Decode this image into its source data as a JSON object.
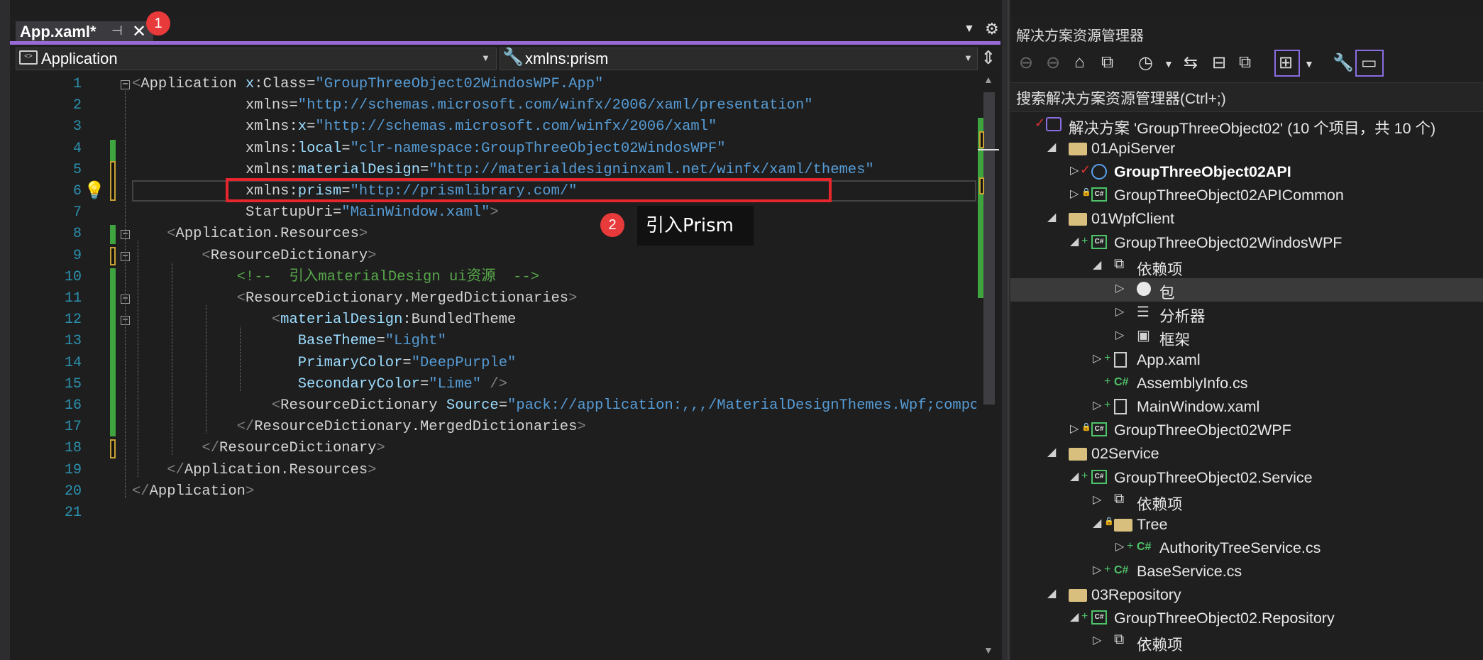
{
  "editor": {
    "tab": {
      "title": "App.xaml*",
      "pin_icon": "pin-icon",
      "close_icon": "close-icon"
    },
    "badge1": "1",
    "badge2": "2",
    "nav_left": "Application",
    "nav_right": "xmlns:prism",
    "tooltip": "引入Prism",
    "line_numbers": [
      "1",
      "2",
      "3",
      "4",
      "5",
      "6",
      "7",
      "8",
      "9",
      "10",
      "11",
      "12",
      "13",
      "14",
      "15",
      "16",
      "17",
      "18",
      "19",
      "20",
      "21"
    ],
    "lines": [
      [
        [
          "br",
          "<"
        ],
        [
          "tag",
          "Application "
        ],
        [
          "ns",
          "x"
        ],
        [
          "eq",
          ":"
        ],
        [
          "attr",
          "Class"
        ],
        [
          "eq",
          "="
        ],
        [
          "str",
          "\"GroupThreeObject02WindosWPF.App\""
        ]
      ],
      [
        [
          "sp",
          "             "
        ],
        [
          "attr",
          "xmlns"
        ],
        [
          "eq",
          "="
        ],
        [
          "str",
          "\"http://schemas.microsoft.com/winfx/2006/xaml/presentation\""
        ]
      ],
      [
        [
          "sp",
          "             "
        ],
        [
          "attr",
          "xmlns"
        ],
        [
          "eq",
          ":"
        ],
        [
          "ns",
          "x"
        ],
        [
          "eq",
          "="
        ],
        [
          "str",
          "\"http://schemas.microsoft.com/winfx/2006/xaml\""
        ]
      ],
      [
        [
          "sp",
          "             "
        ],
        [
          "attr",
          "xmlns"
        ],
        [
          "eq",
          ":"
        ],
        [
          "ns",
          "local"
        ],
        [
          "eq",
          "="
        ],
        [
          "str",
          "\"clr-namespace:GroupThreeObject02WindosWPF\""
        ]
      ],
      [
        [
          "sp",
          "             "
        ],
        [
          "attr",
          "xmlns"
        ],
        [
          "eq",
          ":"
        ],
        [
          "ns",
          "materialDesign"
        ],
        [
          "eq",
          "="
        ],
        [
          "str",
          "\"http://materialdesigninxaml.net/winfx/xaml/themes\""
        ]
      ],
      [
        [
          "sp",
          "             "
        ],
        [
          "attr",
          "xmlns"
        ],
        [
          "eq",
          ":"
        ],
        [
          "ns",
          "prism"
        ],
        [
          "eq",
          "="
        ],
        [
          "str",
          "\"http://prismlibrary.com/\""
        ]
      ],
      [
        [
          "sp",
          "             "
        ],
        [
          "attr",
          "StartupUri"
        ],
        [
          "eq",
          "="
        ],
        [
          "str",
          "\"MainWindow.xaml\""
        ],
        [
          "br",
          ">"
        ]
      ],
      [
        [
          "sp",
          "    "
        ],
        [
          "br",
          "<"
        ],
        [
          "tag",
          "Application.Resources"
        ],
        [
          "br",
          ">"
        ]
      ],
      [
        [
          "sp",
          "        "
        ],
        [
          "br",
          "<"
        ],
        [
          "tag",
          "ResourceDictionary"
        ],
        [
          "br",
          ">"
        ]
      ],
      [
        [
          "sp",
          "            "
        ],
        [
          "cmt",
          "<!--  引入materialDesign ui资源  -->"
        ]
      ],
      [
        [
          "sp",
          "            "
        ],
        [
          "br",
          "<"
        ],
        [
          "tag",
          "ResourceDictionary.MergedDictionaries"
        ],
        [
          "br",
          ">"
        ]
      ],
      [
        [
          "sp",
          "                "
        ],
        [
          "br",
          "<"
        ],
        [
          "ns",
          "materialDesign"
        ],
        [
          "eq",
          ":"
        ],
        [
          "tag",
          "BundledTheme"
        ]
      ],
      [
        [
          "sp",
          "                   "
        ],
        [
          "ns",
          "BaseTheme"
        ],
        [
          "eq",
          "="
        ],
        [
          "str",
          "\"Light\""
        ]
      ],
      [
        [
          "sp",
          "                   "
        ],
        [
          "ns",
          "PrimaryColor"
        ],
        [
          "eq",
          "="
        ],
        [
          "str",
          "\"DeepPurple\""
        ]
      ],
      [
        [
          "sp",
          "                   "
        ],
        [
          "ns",
          "SecondaryColor"
        ],
        [
          "eq",
          "="
        ],
        [
          "str",
          "\"Lime\" "
        ],
        [
          "br",
          "/>"
        ]
      ],
      [
        [
          "sp",
          "                "
        ],
        [
          "br",
          "<"
        ],
        [
          "tag",
          "ResourceDictionary "
        ],
        [
          "ns",
          "Source"
        ],
        [
          "eq",
          "="
        ],
        [
          "str",
          "\"pack://application:,,,/MaterialDesignThemes.Wpf;component/Themes/MaterialDesignTheme.Defaults.xaml\""
        ]
      ],
      [
        [
          "sp",
          "            "
        ],
        [
          "br",
          "</"
        ],
        [
          "tag",
          "ResourceDictionary.MergedDictionaries"
        ],
        [
          "br",
          ">"
        ]
      ],
      [
        [
          "sp",
          "        "
        ],
        [
          "br",
          "</"
        ],
        [
          "tag",
          "ResourceDictionary"
        ],
        [
          "br",
          ">"
        ]
      ],
      [
        [
          "sp",
          "    "
        ],
        [
          "br",
          "</"
        ],
        [
          "tag",
          "Application.Resources"
        ],
        [
          "br",
          ">"
        ]
      ],
      [
        [
          "br",
          "</"
        ],
        [
          "tag",
          "Application"
        ],
        [
          "br",
          ">"
        ]
      ],
      []
    ]
  },
  "solution_explorer": {
    "title": "解决方案资源管理器",
    "search_placeholder": "搜索解决方案资源管理器(Ctrl+;)",
    "toolbar_icons": [
      "back-icon",
      "forward-icon",
      "home-icon",
      "vs-switch-icon",
      "history-icon",
      "dropdown-icon",
      "sync-icon",
      "collapse-icon",
      "copy-icon",
      "show-all-icon",
      "dropdown-icon",
      "properties-icon",
      "preview-icon"
    ],
    "tree": [
      {
        "label": "解决方案 'GroupThreeObject02' (10 个项目，共 10 个)",
        "icon": "solution-icon",
        "depth": 0,
        "exp": "",
        "check": true
      },
      {
        "label": "01ApiServer",
        "icon": "folder-icon",
        "depth": 1,
        "exp": "◢"
      },
      {
        "label": "GroupThreeObject02API",
        "icon": "web-project-icon",
        "depth": 2,
        "exp": "▷",
        "check": true,
        "bold": true
      },
      {
        "label": "GroupThreeObject02APICommon",
        "icon": "csharp-project-icon",
        "depth": 2,
        "exp": "▷",
        "lock": true
      },
      {
        "label": "01WpfClient",
        "icon": "folder-icon",
        "depth": 1,
        "exp": "◢"
      },
      {
        "label": "GroupThreeObject02WindosWPF",
        "icon": "csharp-project-icon",
        "depth": 2,
        "exp": "◢",
        "plus": true
      },
      {
        "label": "依赖项",
        "icon": "dependencies-icon",
        "depth": 3,
        "exp": "◢"
      },
      {
        "label": "包",
        "icon": "package-icon",
        "depth": 4,
        "exp": "▷",
        "selected": true
      },
      {
        "label": "分析器",
        "icon": "analyzer-icon",
        "depth": 4,
        "exp": "▷"
      },
      {
        "label": "框架",
        "icon": "framework-icon",
        "depth": 4,
        "exp": "▷"
      },
      {
        "label": "App.xaml",
        "icon": "xaml-file-icon",
        "depth": 3,
        "exp": "▷",
        "plus": true
      },
      {
        "label": "AssemblyInfo.cs",
        "icon": "csharp-file-icon",
        "depth": 3,
        "exp": "",
        "plus": true
      },
      {
        "label": "MainWindow.xaml",
        "icon": "xaml-file-icon",
        "depth": 3,
        "exp": "▷",
        "plus": true
      },
      {
        "label": "GroupThreeObject02WPF",
        "icon": "csharp-project-icon",
        "depth": 2,
        "exp": "▷",
        "lock": true
      },
      {
        "label": "02Service",
        "icon": "folder-icon",
        "depth": 1,
        "exp": "◢"
      },
      {
        "label": "GroupThreeObject02.Service",
        "icon": "csharp-project-icon",
        "depth": 2,
        "exp": "◢",
        "plus": true
      },
      {
        "label": "依赖项",
        "icon": "dependencies-icon",
        "depth": 3,
        "exp": "▷"
      },
      {
        "label": "Tree",
        "icon": "folder-icon",
        "depth": 3,
        "exp": "◢",
        "lock": true
      },
      {
        "label": "AuthorityTreeService.cs",
        "icon": "csharp-file-icon",
        "depth": 4,
        "exp": "▷",
        "plus": true
      },
      {
        "label": "BaseService.cs",
        "icon": "csharp-file-icon",
        "depth": 3,
        "exp": "▷",
        "plus": true
      },
      {
        "label": "03Repository",
        "icon": "folder-icon",
        "depth": 1,
        "exp": "◢"
      },
      {
        "label": "GroupThreeObject02.Repository",
        "icon": "csharp-project-icon",
        "depth": 2,
        "exp": "◢",
        "plus": true
      },
      {
        "label": "依赖项",
        "icon": "dependencies-icon",
        "depth": 3,
        "exp": "▷"
      }
    ]
  },
  "colors": {
    "accent": "#9a6bd7",
    "annotation_red": "#e6262c",
    "string": "#569cd6",
    "comment": "#57a64a",
    "line_number": "#2b91af"
  }
}
